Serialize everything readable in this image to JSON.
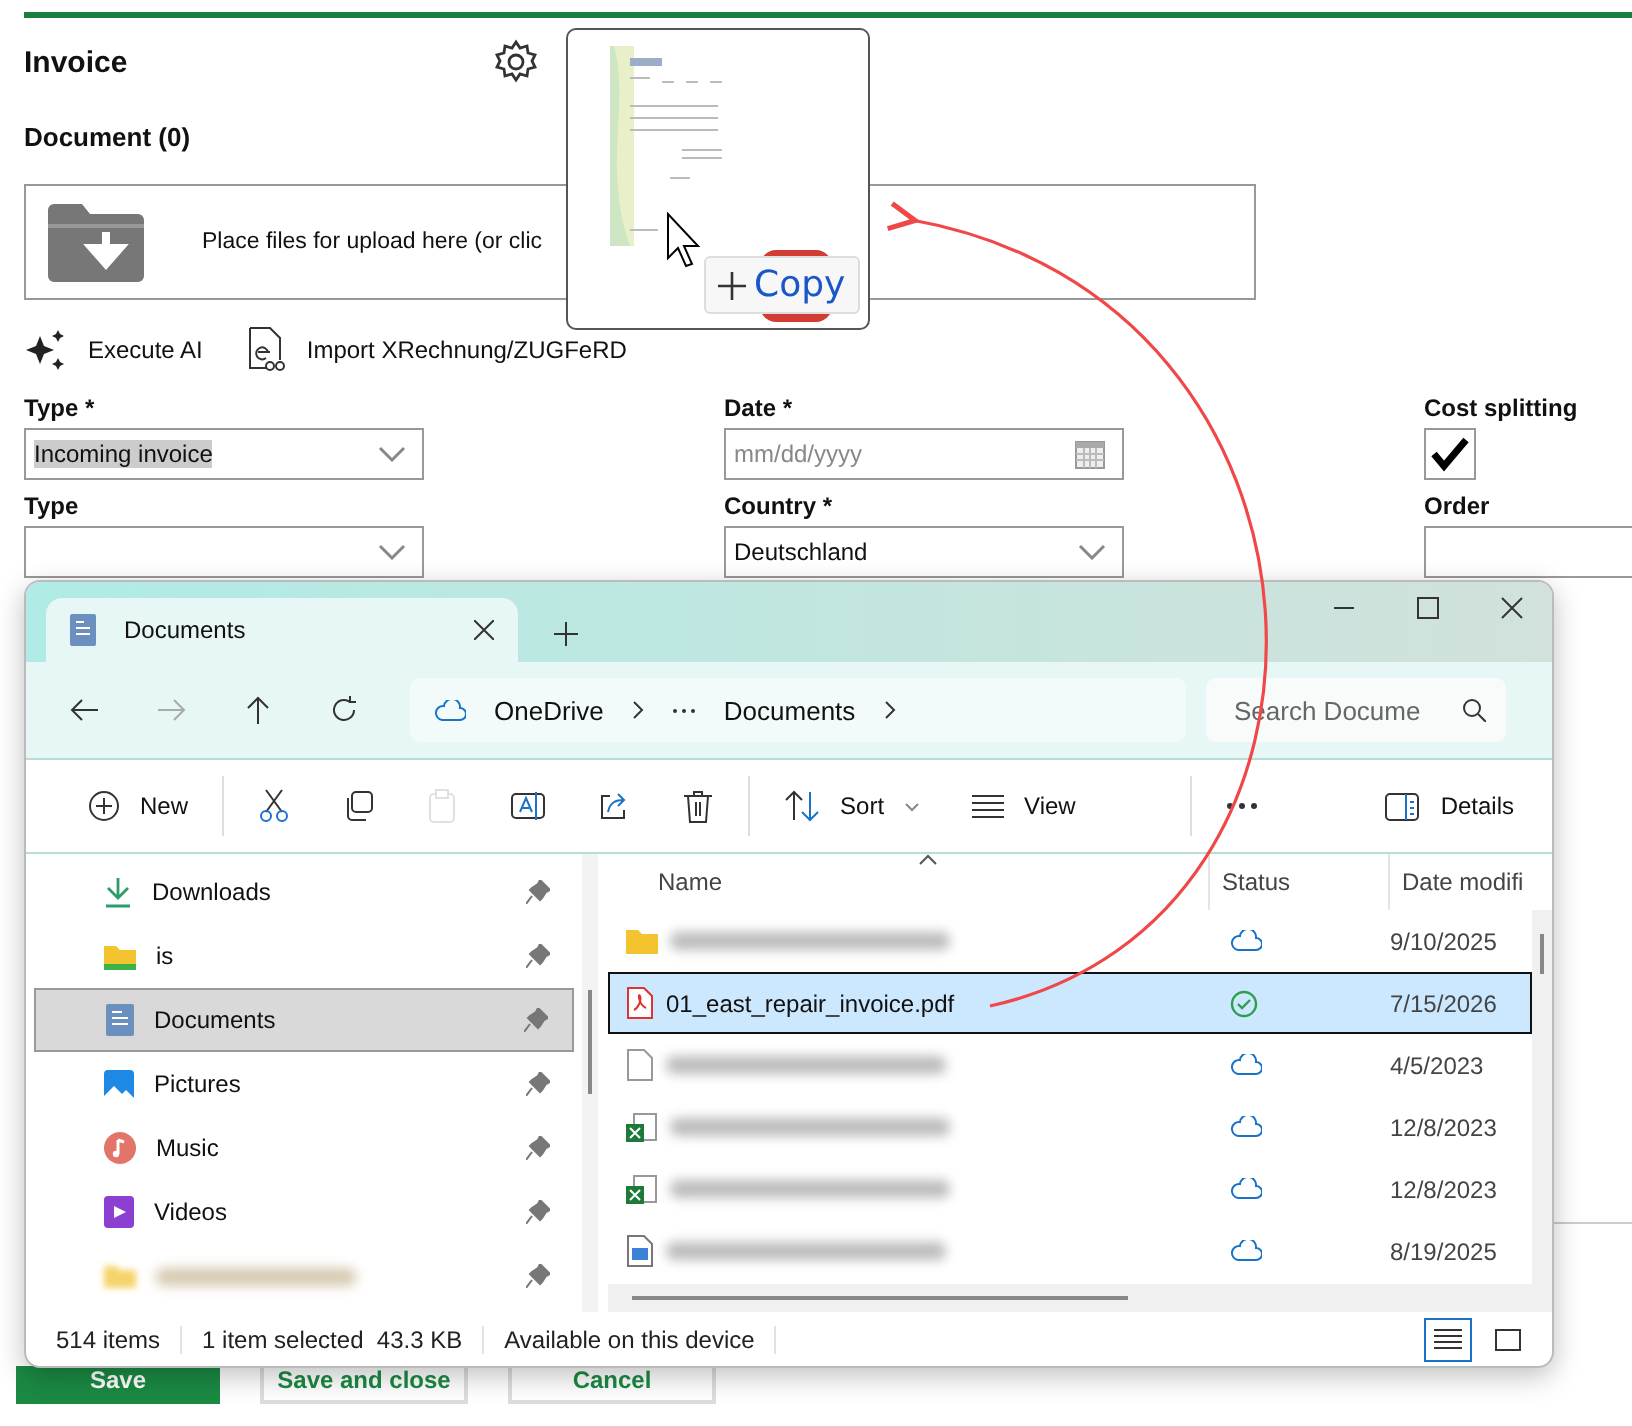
{
  "form": {
    "title": "Invoice",
    "section": "Document (0)",
    "upload_text": "Place files for upload here (or clic",
    "actions": [
      {
        "label": "Execute AI",
        "kind": "ai"
      },
      {
        "label": "Import XRechnung/ZUGFeRD",
        "kind": "import"
      }
    ],
    "fields": [
      {
        "label": "Type *",
        "kind": "select",
        "value": "Incoming invoice"
      },
      {
        "label": "Date *",
        "kind": "date",
        "placeholder": "mm/dd/yyyy"
      },
      {
        "label": "Cost splitting",
        "kind": "checkbox",
        "checked": true
      },
      {
        "label": "Type",
        "kind": "select"
      },
      {
        "label": "Country *",
        "kind": "select",
        "value": "Deutschland"
      },
      {
        "label": "Order",
        "kind": "text"
      }
    ],
    "buttons": [
      {
        "label": "Save",
        "kind": "primary"
      },
      {
        "label": "Save and close",
        "kind": "secondary"
      },
      {
        "label": "Cancel",
        "kind": "secondary"
      }
    ]
  },
  "drag_preview": {
    "badge": "Copy"
  },
  "explorer": {
    "tab": "Documents",
    "breadcrumb": [
      "OneDrive",
      "Documents"
    ],
    "search": {
      "placeholder": "Search Docume"
    },
    "toolbar": [
      {
        "kind": "new",
        "label": "New"
      },
      {
        "kind": "cut"
      },
      {
        "kind": "copy"
      },
      {
        "kind": "paste",
        "disabled": true
      },
      {
        "kind": "rename"
      },
      {
        "kind": "share"
      },
      {
        "kind": "delete"
      },
      {
        "kind": "sort",
        "label": "Sort"
      },
      {
        "kind": "view",
        "label": "View"
      },
      {
        "kind": "more"
      },
      {
        "kind": "details",
        "label": "Details"
      }
    ],
    "sidebar": [
      {
        "kind": "downloads",
        "label": "Downloads",
        "selected": false
      },
      {
        "kind": "folder",
        "label": "is",
        "selected": false
      },
      {
        "kind": "documents",
        "label": "Documents",
        "selected": true
      },
      {
        "kind": "pictures",
        "label": "Pictures",
        "selected": false
      },
      {
        "kind": "music",
        "label": "Music",
        "selected": false
      },
      {
        "kind": "videos",
        "label": "Videos",
        "selected": false
      },
      {
        "kind": "blurred",
        "selected": false
      }
    ],
    "columns": [
      "Name",
      "Status",
      "Date modifi"
    ],
    "files": [
      {
        "kind": "folder",
        "synced": false,
        "date": "9/10/2025",
        "selected": false
      },
      {
        "kind": "pdf",
        "name": "01_east_repair_invoice.pdf",
        "synced": true,
        "date": "7/15/2026",
        "selected": true
      },
      {
        "kind": "file",
        "synced": false,
        "date": "4/5/2023",
        "selected": false
      },
      {
        "kind": "excel",
        "synced": false,
        "date": "12/8/2023",
        "selected": false
      },
      {
        "kind": "excel",
        "synced": false,
        "date": "12/8/2023",
        "selected": false
      },
      {
        "kind": "image",
        "synced": false,
        "date": "8/19/2025",
        "selected": false
      }
    ],
    "status_bar": [
      "514 items",
      "1 item selected  43.3 KB",
      "Available on this device"
    ]
  }
}
